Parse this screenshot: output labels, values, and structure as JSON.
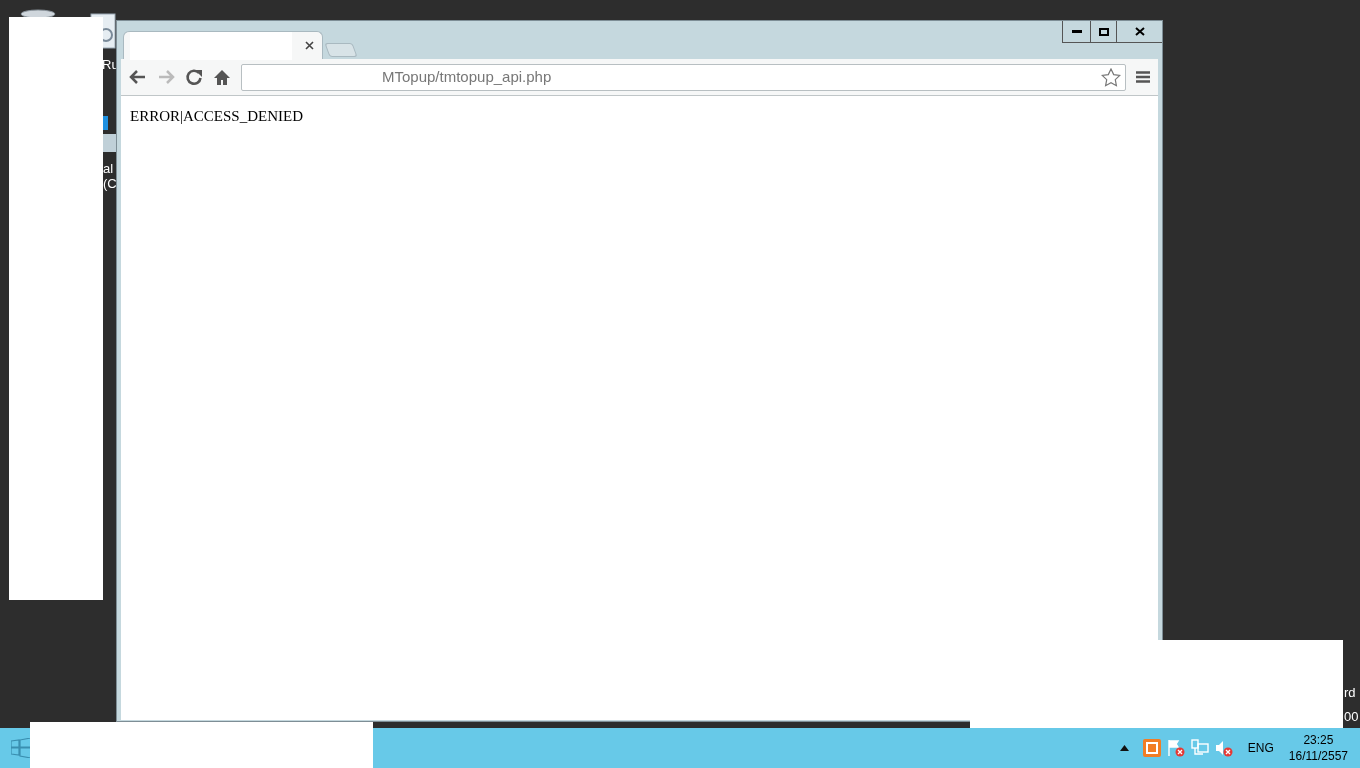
{
  "desktop": {
    "icon_labels": [
      "Ru",
      "al",
      "(C",
      "rd",
      "00"
    ]
  },
  "browser": {
    "tabs": [
      {
        "selected": true
      }
    ],
    "nav": {
      "back_disabled": false,
      "forward_disabled": true
    },
    "url": "MTopup/tmtopup_api.php",
    "page_text": "ERROR|ACCESS_DENIED"
  },
  "taskbar": {
    "language": "ENG",
    "time": "23:25",
    "date": "16/11/2557"
  }
}
